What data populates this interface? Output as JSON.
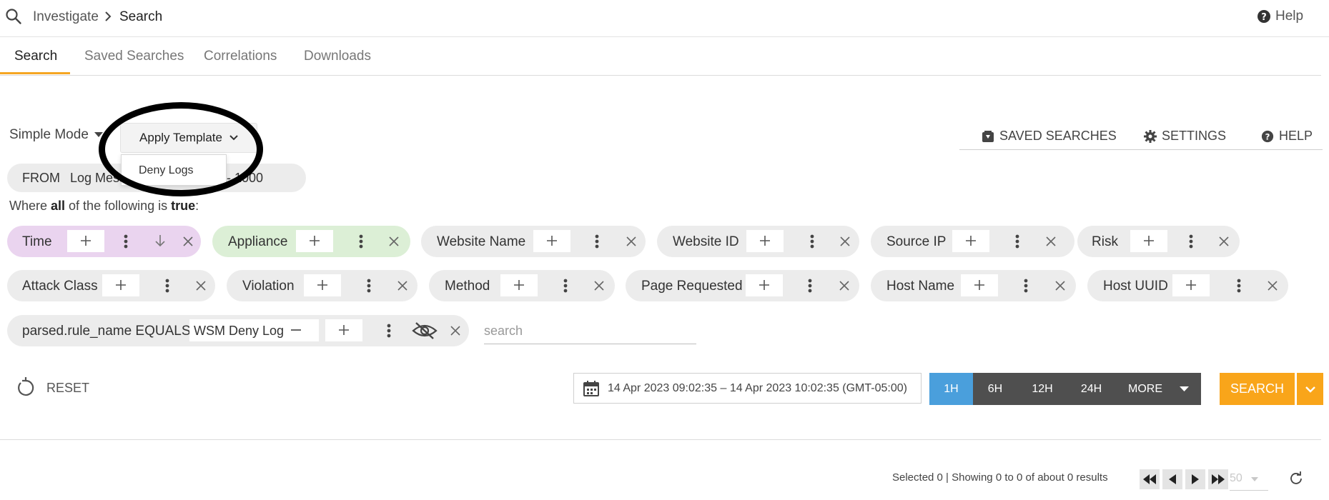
{
  "breadcrumb": {
    "root": "Investigate",
    "current": "Search"
  },
  "top_help": "Help",
  "tabs": [
    {
      "label": "Search",
      "active": true
    },
    {
      "label": "Saved Searches",
      "active": false
    },
    {
      "label": "Correlations",
      "active": false
    },
    {
      "label": "Downloads",
      "active": false
    }
  ],
  "mode_label": "Simple Mode",
  "apply_template": {
    "label": "Apply Template",
    "options": [
      "Deny Logs"
    ]
  },
  "actions": {
    "saved_searches": "SAVED SEARCHES",
    "settings": "SETTINGS",
    "help": "HELP"
  },
  "from_clause": {
    "from": "FROM",
    "source": "Log Mess",
    "limit": "- 1000"
  },
  "where_text": {
    "pre": "Where ",
    "all": "all",
    "mid": " of the following is ",
    "true": "true",
    "post": ":"
  },
  "filters": [
    {
      "label": "Time",
      "color": "#ead4ef"
    },
    {
      "label": "Appliance",
      "color": "#dcefd6"
    },
    {
      "label": "Website Name"
    },
    {
      "label": "Website ID"
    },
    {
      "label": "Source IP"
    },
    {
      "label": "Risk"
    },
    {
      "label": "Attack Class"
    },
    {
      "label": "Violation"
    },
    {
      "label": "Method"
    },
    {
      "label": "Page Requested"
    },
    {
      "label": "Host Name"
    },
    {
      "label": "Host UUID"
    }
  ],
  "condition": {
    "label": "parsed.rule_name EQUALS",
    "value": "WSM Deny Log"
  },
  "search_placeholder": "search",
  "reset_label": "RESET",
  "date_range": "14 Apr 2023 09:02:35 – 14 Apr 2023 10:02:35 (GMT-05:00)",
  "ranges": [
    {
      "label": "1H",
      "active": true
    },
    {
      "label": "6H"
    },
    {
      "label": "12H"
    },
    {
      "label": "24H"
    },
    {
      "label": "MORE"
    }
  ],
  "search_button": "SEARCH",
  "results_text": "Selected 0 | Showing 0 to 0 of about 0 results",
  "per_page": "50",
  "colors": {
    "accent": "#f9a51a",
    "active_range": "#4a9fdc",
    "range_bg": "#4f4f4f"
  }
}
